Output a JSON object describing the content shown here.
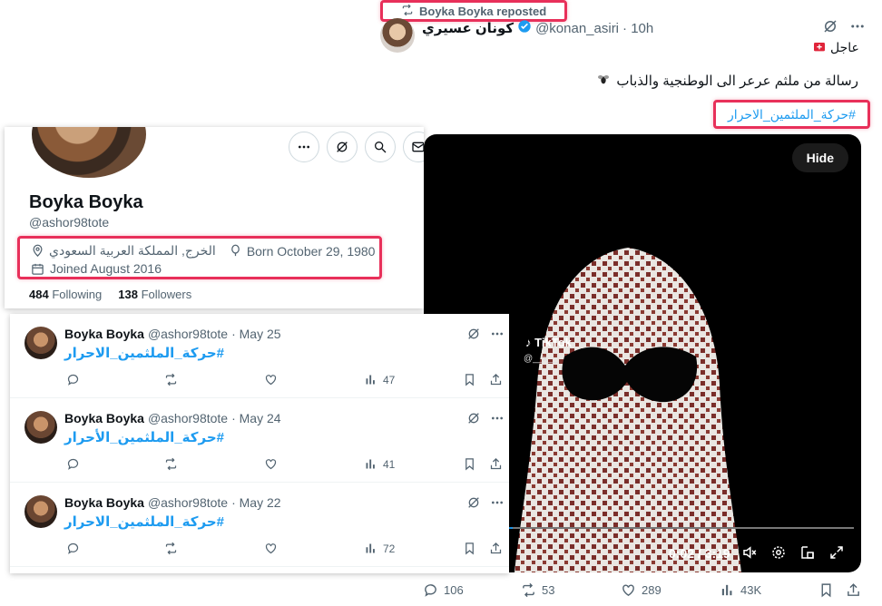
{
  "background_tweet": {
    "repost_text": "Boyka Boyka reposted",
    "author_name": "كونان عسيري",
    "author_handle": "@konan_asiri",
    "time": "· 10h",
    "urgent_label": "عاجل",
    "text": "رسالة من ملثم عرعر الى الوطنجية والذباب",
    "hashtag": "#حركة_الملثمين_الاحرار",
    "video": {
      "hide_label": "Hide",
      "tiktok_label": "TikTok",
      "tiktok_user": "@__x__",
      "time": "0:02 / 3:19",
      "progress": 0.01
    },
    "stats": {
      "replies": "106",
      "reposts": "53",
      "likes": "289",
      "views": "43K"
    }
  },
  "profile": {
    "name": "Boyka Boyka",
    "handle": "@ashor98tote",
    "location": "الخرج, المملكة العربية السعودي",
    "born": "Born October 29, 1980",
    "joined": "Joined August 2016",
    "following_count": "484",
    "following_label": "Following",
    "followers_count": "138",
    "followers_label": "Followers"
  },
  "timeline": [
    {
      "name": "Boyka Boyka",
      "handle": "@ashor98tote",
      "date": "· May 25",
      "text": "#حركة_الملثمين_الاحرار",
      "views": "47"
    },
    {
      "name": "Boyka Boyka",
      "handle": "@ashor98tote",
      "date": "· May 24",
      "text": "#حركة_الملثمين_الأحرار",
      "views": "41"
    },
    {
      "name": "Boyka Boyka",
      "handle": "@ashor98tote",
      "date": "· May 22",
      "text": "#حركة_الملثمين_الاحرار",
      "views": "72"
    }
  ],
  "colors": {
    "accent": "#1d9bf0",
    "highlight": "#e8305a"
  }
}
